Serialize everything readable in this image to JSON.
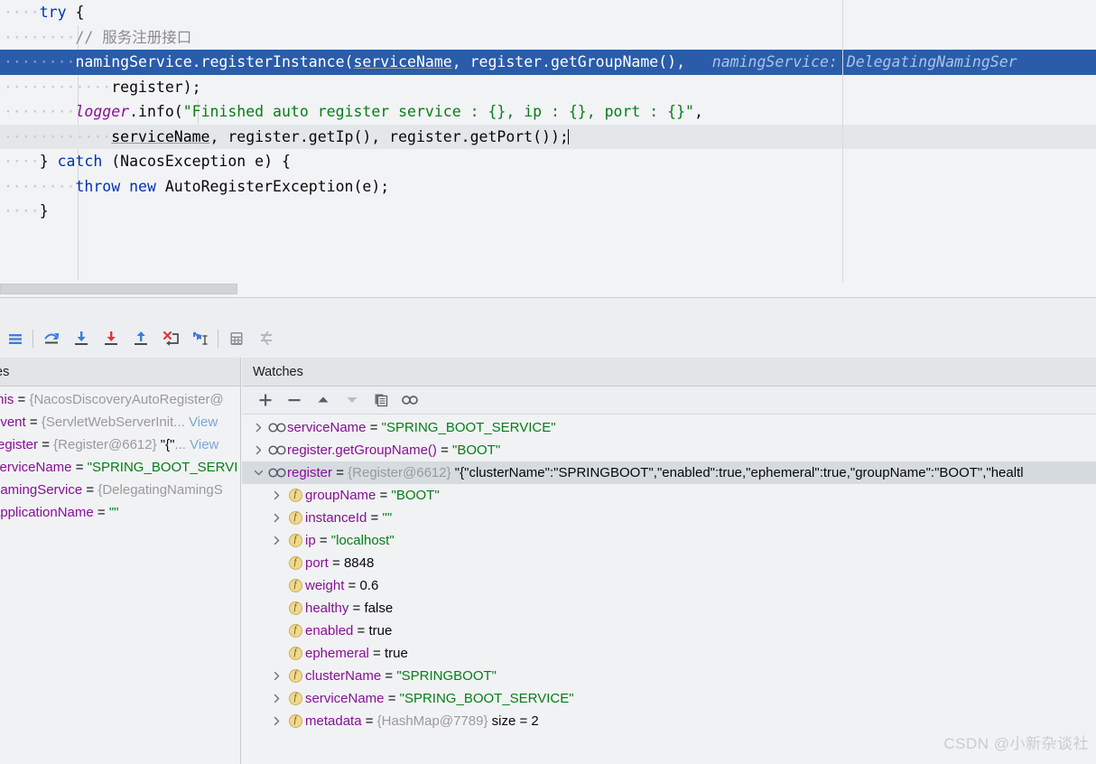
{
  "editor": {
    "lines": [
      {
        "indent_dots": 4,
        "segments": [
          {
            "t": "try",
            "c": "kw"
          },
          {
            "t": " ",
            "c": "plain"
          },
          {
            "t": "{",
            "c": "plain"
          }
        ]
      },
      {
        "indent_dots": 8,
        "segments": [
          {
            "t": "// 服务注册接口",
            "c": "cmt"
          }
        ]
      },
      {
        "indent_dots": 8,
        "selected": true,
        "segments": [
          {
            "t": "namingService",
            "c": "plain"
          },
          {
            "t": ".registerInstance(",
            "c": "plain"
          },
          {
            "t": "serviceName",
            "c": "und"
          },
          {
            "t": ", register.getGroupName(), ",
            "c": "plain"
          },
          {
            "t": "  namingService: DelegatingNamingSer",
            "c": "hint"
          }
        ]
      },
      {
        "indent_dots": 12,
        "segments": [
          {
            "t": "register);",
            "c": "plain"
          }
        ]
      },
      {
        "indent_dots": 8,
        "segments": [
          {
            "t": "logger",
            "c": "fld"
          },
          {
            "t": ".info(",
            "c": "plain"
          },
          {
            "t": "\"Finished auto register service : {}, ip : {}, port : {}\"",
            "c": "str"
          },
          {
            "t": ",",
            "c": "plain"
          }
        ]
      },
      {
        "indent_dots": 12,
        "caretline": true,
        "segments": [
          {
            "t": "serviceName",
            "c": "und"
          },
          {
            "t": ", register.getIp(), register.getPort());",
            "c": "plain"
          }
        ],
        "caret_at_end": true
      },
      {
        "indent_dots": 4,
        "segments": [
          {
            "t": "} ",
            "c": "plain"
          },
          {
            "t": "catch",
            "c": "kw"
          },
          {
            "t": " (NacosException e) {",
            "c": "plain"
          }
        ]
      },
      {
        "indent_dots": 8,
        "segments": [
          {
            "t": "throw",
            "c": "kw"
          },
          {
            "t": " ",
            "c": "plain"
          },
          {
            "t": "new",
            "c": "kw"
          },
          {
            "t": " AutoRegisterException(e);",
            "c": "plain"
          }
        ]
      },
      {
        "indent_dots": 4,
        "segments": [
          {
            "t": "}",
            "c": "plain"
          }
        ]
      }
    ],
    "inline_hint": "namingService: DelegatingNamingSer",
    "selection_color": "#2a5caa",
    "caret_line_color": "#e3e7ea"
  },
  "debug_toolbar": {
    "buttons": [
      {
        "name": "show-execution-point-icon",
        "title": "Show Execution Point"
      },
      {
        "name": "step-over-icon",
        "title": "Step Over"
      },
      {
        "name": "step-into-icon",
        "title": "Step Into"
      },
      {
        "name": "force-step-into-icon",
        "title": "Force Step Into"
      },
      {
        "name": "step-out-icon",
        "title": "Step Out"
      },
      {
        "name": "drop-frame-icon",
        "title": "Drop Frame"
      },
      {
        "name": "run-to-cursor-icon",
        "title": "Run to Cursor"
      },
      {
        "name": "evaluate-expression-icon",
        "title": "Evaluate Expression"
      },
      {
        "name": "mute-breakpoints-icon",
        "title": "Mute Breakpoints"
      }
    ]
  },
  "variables_pane": {
    "tab_label": "es",
    "rows": [
      {
        "text": "this = {NacosDiscoveryAutoRegister@",
        "parts": [
          {
            "t": "this",
            "c": "vname"
          },
          {
            "t": " = ",
            "c": "eq"
          },
          {
            "t": "{NacosDiscoveryAutoRegister@",
            "c": "vval-ref"
          }
        ]
      },
      {
        "parts": [
          {
            "t": "event",
            "c": "vname"
          },
          {
            "t": " = ",
            "c": "eq"
          },
          {
            "t": "{ServletWebServerInit",
            "c": "vval-ref"
          },
          {
            "t": "... View",
            "c": "vlink"
          }
        ]
      },
      {
        "parts": [
          {
            "t": "register",
            "c": "vname"
          },
          {
            "t": " = ",
            "c": "eq"
          },
          {
            "t": "{Register@6612} ",
            "c": "vval-ref"
          },
          {
            "t": "\"{\"",
            "c": "vval-plain"
          },
          {
            "t": "... View",
            "c": "vlink"
          }
        ]
      },
      {
        "parts": [
          {
            "t": "serviceName",
            "c": "vname"
          },
          {
            "t": " = ",
            "c": "eq"
          },
          {
            "t": "\"SPRING_BOOT_SERVI",
            "c": "vval-str"
          }
        ]
      },
      {
        "parts": [
          {
            "t": "namingService",
            "c": "vname"
          },
          {
            "t": " = ",
            "c": "eq"
          },
          {
            "t": "{DelegatingNamingS",
            "c": "vval-ref"
          }
        ]
      },
      {
        "parts": [
          {
            "t": "applicationName",
            "c": "vname"
          },
          {
            "t": " = ",
            "c": "eq"
          },
          {
            "t": "\"\"",
            "c": "vval-str"
          }
        ]
      }
    ]
  },
  "watches_pane": {
    "tab_label": "Watches",
    "toolbar": [
      {
        "name": "add-watch-button",
        "label": "+"
      },
      {
        "name": "remove-watch-button",
        "label": "−"
      },
      {
        "name": "move-watch-up-button",
        "label": "▲"
      },
      {
        "name": "move-watch-down-button",
        "label": "▼"
      },
      {
        "name": "copy-value-button",
        "label": "copy"
      },
      {
        "name": "watch-glasses-button",
        "label": "oo"
      }
    ],
    "rows": [
      {
        "indent": 0,
        "arrow": "collapsed",
        "icon": "watch",
        "parts": [
          {
            "t": "serviceName",
            "c": "vname"
          },
          {
            "t": " = ",
            "c": "eq"
          },
          {
            "t": "\"SPRING_BOOT_SERVICE\"",
            "c": "vval-str"
          }
        ]
      },
      {
        "indent": 0,
        "arrow": "collapsed",
        "icon": "watch",
        "parts": [
          {
            "t": "register.getGroupName()",
            "c": "vname"
          },
          {
            "t": " = ",
            "c": "eq"
          },
          {
            "t": "\"BOOT\"",
            "c": "vval-str"
          }
        ]
      },
      {
        "indent": 0,
        "arrow": "expanded",
        "icon": "watch",
        "selected": true,
        "parts": [
          {
            "t": "register",
            "c": "vname"
          },
          {
            "t": " = ",
            "c": "eq"
          },
          {
            "t": "{Register@6612} ",
            "c": "vval-ref"
          },
          {
            "t": "\"{\"clusterName\":\"SPRINGBOOT\",\"enabled\":true,\"ephemeral\":true,\"groupName\":\"BOOT\",\"healtl",
            "c": "vval-plain"
          }
        ]
      },
      {
        "indent": 1,
        "arrow": "collapsed",
        "icon": "field",
        "parts": [
          {
            "t": "groupName",
            "c": "vname"
          },
          {
            "t": " = ",
            "c": "eq"
          },
          {
            "t": "\"BOOT\"",
            "c": "vval-str"
          }
        ]
      },
      {
        "indent": 1,
        "arrow": "collapsed",
        "icon": "field",
        "parts": [
          {
            "t": "instanceId",
            "c": "vname"
          },
          {
            "t": " = ",
            "c": "eq"
          },
          {
            "t": "\"\"",
            "c": "vval-str"
          }
        ]
      },
      {
        "indent": 1,
        "arrow": "collapsed",
        "icon": "field",
        "parts": [
          {
            "t": "ip",
            "c": "vname"
          },
          {
            "t": " = ",
            "c": "eq"
          },
          {
            "t": "\"localhost\"",
            "c": "vval-str"
          }
        ]
      },
      {
        "indent": 1,
        "arrow": "none",
        "icon": "field",
        "parts": [
          {
            "t": "port",
            "c": "vname"
          },
          {
            "t": " = ",
            "c": "eq"
          },
          {
            "t": "8848",
            "c": "vval-plain"
          }
        ]
      },
      {
        "indent": 1,
        "arrow": "none",
        "icon": "field",
        "parts": [
          {
            "t": "weight",
            "c": "vname"
          },
          {
            "t": " = ",
            "c": "eq"
          },
          {
            "t": "0.6",
            "c": "vval-plain"
          }
        ]
      },
      {
        "indent": 1,
        "arrow": "none",
        "icon": "field",
        "parts": [
          {
            "t": "healthy",
            "c": "vname"
          },
          {
            "t": " = ",
            "c": "eq"
          },
          {
            "t": "false",
            "c": "vval-plain"
          }
        ]
      },
      {
        "indent": 1,
        "arrow": "none",
        "icon": "field",
        "parts": [
          {
            "t": "enabled",
            "c": "vname"
          },
          {
            "t": " = ",
            "c": "eq"
          },
          {
            "t": "true",
            "c": "vval-plain"
          }
        ]
      },
      {
        "indent": 1,
        "arrow": "none",
        "icon": "field",
        "parts": [
          {
            "t": "ephemeral",
            "c": "vname"
          },
          {
            "t": " = ",
            "c": "eq"
          },
          {
            "t": "true",
            "c": "vval-plain"
          }
        ]
      },
      {
        "indent": 1,
        "arrow": "collapsed",
        "icon": "field",
        "parts": [
          {
            "t": "clusterName",
            "c": "vname"
          },
          {
            "t": " = ",
            "c": "eq"
          },
          {
            "t": "\"SPRINGBOOT\"",
            "c": "vval-str"
          }
        ]
      },
      {
        "indent": 1,
        "arrow": "collapsed",
        "icon": "field",
        "parts": [
          {
            "t": "serviceName",
            "c": "vname"
          },
          {
            "t": " = ",
            "c": "eq"
          },
          {
            "t": "\"SPRING_BOOT_SERVICE\"",
            "c": "vval-str"
          }
        ]
      },
      {
        "indent": 1,
        "arrow": "collapsed",
        "icon": "field",
        "parts": [
          {
            "t": "metadata",
            "c": "vname"
          },
          {
            "t": " = ",
            "c": "eq"
          },
          {
            "t": "{HashMap@7789} ",
            "c": "vval-ref"
          },
          {
            "t": " size = 2",
            "c": "vval-plain"
          }
        ]
      }
    ]
  },
  "watermark": {
    "text": "CSDN @小新杂谈社"
  }
}
